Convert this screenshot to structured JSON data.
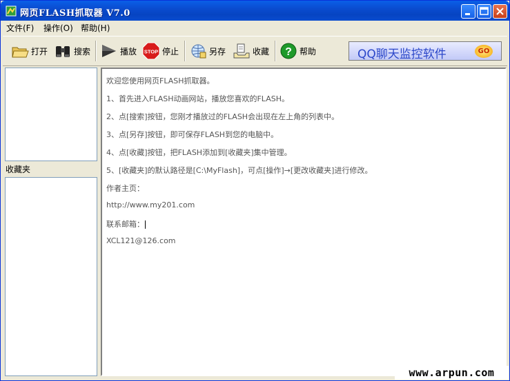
{
  "window": {
    "title": "网页FLASH抓取器 V7.0"
  },
  "menu": [
    {
      "label": "文件(F)"
    },
    {
      "label": "操作(O)"
    },
    {
      "label": "帮助(H)"
    }
  ],
  "toolbar": {
    "open": "打开",
    "search": "搜索",
    "play": "播放",
    "stop": "停止",
    "save_as": "另存",
    "favorite": "收藏",
    "help": "帮助",
    "stop_sign_text": "STOP",
    "banner": "QQ聊天监控软件",
    "banner_badge": "GO"
  },
  "sidebar": {
    "favorites_label": "收藏夹"
  },
  "content": {
    "lines": [
      "欢迎您使用网页FLASH抓取器。",
      "1、首先进入FLASH动画网站，播放您喜欢的FLASH。",
      "2、点[搜索]按钮，您刚才播放过的FLASH会出现在左上角的列表中。",
      "3、点[另存]按钮，即可保存FLASH到您的电脑中。",
      "4、点[收藏]按钮，把FLASH添加到[收藏夹]集中管理。",
      "5、[收藏夹]的默认路径是[C:\\MyFlash]，可点[操作]→[更改收藏夹]进行修改。",
      "作者主页：",
      "http://www.my201.com",
      "联系邮箱：",
      "XCL121@126.com"
    ]
  },
  "watermark": "www.arpun.com"
}
